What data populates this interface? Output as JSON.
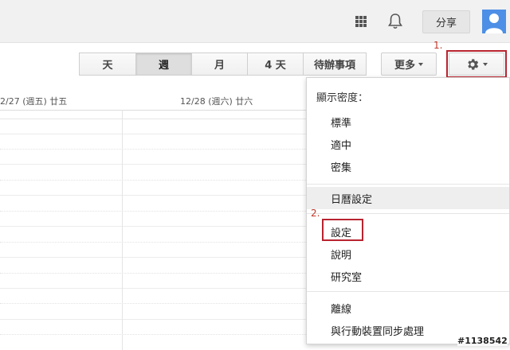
{
  "toolbar": {
    "share_label": "分享"
  },
  "views": {
    "day": "天",
    "week": "週",
    "month": "月",
    "four_days": "4 天",
    "agenda": "待辦事項"
  },
  "more_label": "更多",
  "annotations": {
    "step1": "1.",
    "step2": "2."
  },
  "day_headers": {
    "left": "2/27 (週五) 廿五",
    "right": "12/28 (週六) 廿六"
  },
  "menu": {
    "density_heading": "顯示密度：",
    "density_options": [
      "標準",
      "適中",
      "密集"
    ],
    "calendar_settings": "日曆設定",
    "settings": "設定",
    "help": "說明",
    "labs": "研究室",
    "offline": "離線",
    "mobile_sync": "與行動裝置同步處理"
  },
  "watermark": "#1138542",
  "colors": {
    "highlight": "#b8242f",
    "avatar": "#4d8fe6"
  }
}
